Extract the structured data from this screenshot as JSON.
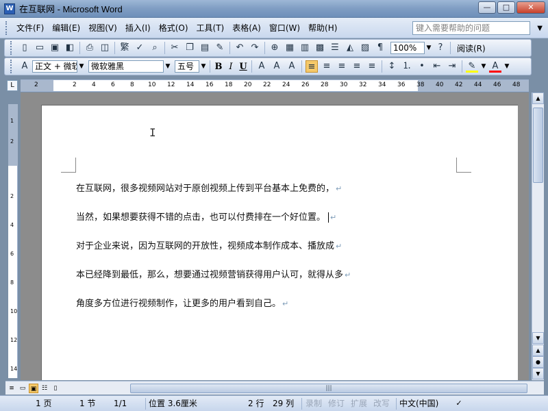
{
  "window": {
    "title": "在互联网 - Microsoft Word",
    "icon_letter": "W"
  },
  "menu": {
    "items": [
      "文件(F)",
      "编辑(E)",
      "视图(V)",
      "插入(I)",
      "格式(O)",
      "工具(T)",
      "表格(A)",
      "窗口(W)",
      "帮助(H)"
    ],
    "help_placeholder": "键入需要帮助的问题"
  },
  "toolbar": {
    "zoom": "100%",
    "read_label": "阅读(R)"
  },
  "format": {
    "style": "正文 + 微软",
    "font": "微软雅黑",
    "size": "五号"
  },
  "ruler": {
    "marks": [
      "2",
      "2",
      "4",
      "6",
      "8",
      "10",
      "12",
      "14",
      "16",
      "18",
      "20",
      "22",
      "24",
      "26",
      "28",
      "30",
      "32",
      "34",
      "36",
      "38",
      "40",
      "42",
      "44",
      "46",
      "48"
    ],
    "vmarks": [
      "1",
      "2",
      "2",
      "4",
      "6",
      "8",
      "10",
      "12",
      "14"
    ]
  },
  "document": {
    "lines": [
      "在互联网，很多视频网站对于原创视频上传到平台基本上免费的，",
      "当然，如果想要获得不错的点击，也可以付费排在一个好位置。",
      "对于企业来说，因为互联网的开放性，视频成本制作成本、播放成",
      "本已经降到最低，那么，想要通过视频营销获得用户认可，就得从多",
      "角度多方位进行视频制作，让更多的用户看到自己。"
    ],
    "para_mark": "↵"
  },
  "status": {
    "page": "1 页",
    "section": "1 节",
    "page_of": "1/1",
    "position": "位置 3.6厘米",
    "line": "2 行",
    "col": "29 列",
    "rec": "录制",
    "trk": "修订",
    "ext": "扩展",
    "ovr": "改写",
    "lang": "中文(中国)"
  }
}
